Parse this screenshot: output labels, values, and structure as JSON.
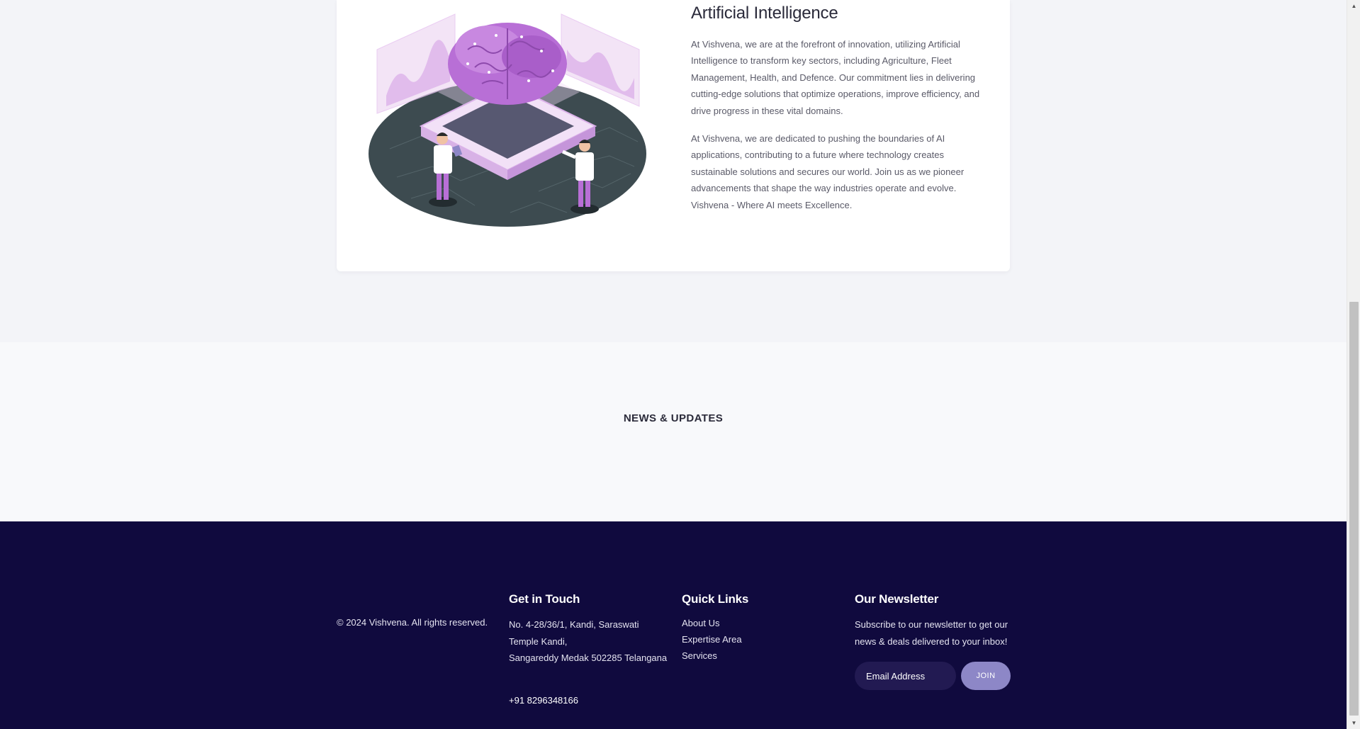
{
  "ai": {
    "title": "Artificial Intelligence",
    "paragraph1": "At Vishvena, we are at the forefront of innovation, utilizing Artificial Intelligence to transform key sectors, including Agriculture, Fleet Management, Health, and Defence. Our commitment lies in delivering cutting-edge solutions that optimize operations, improve efficiency, and drive progress in these vital domains.",
    "paragraph2": "At Vishvena, we are dedicated to pushing the boundaries of AI applications, contributing to a future where technology creates sustainable solutions and secures our world. Join us as we pioneer advancements that shape the way industries operate and evolve. Vishvena - Where AI meets Excellence."
  },
  "news": {
    "title": "NEWS & UPDATES"
  },
  "footer": {
    "copyright": "© 2024 Vishvena. All rights reserved.",
    "get_in_touch": {
      "heading": "Get in Touch",
      "address_line1": "No. 4-28/36/1, Kandi, Saraswati",
      "address_line2": "Temple Kandi,",
      "address_line3": "Sangareddy Medak 502285 Telangana",
      "phone": "+91 8296348166"
    },
    "quick_links": {
      "heading": "Quick Links",
      "items": [
        "About Us",
        "Expertise Area",
        "Services"
      ]
    },
    "newsletter": {
      "heading": "Our Newsletter",
      "description": "Subscribe to our newsletter to get our news & deals delivered to your inbox!",
      "email_placeholder": "Email Address",
      "join_label": "JOIN"
    }
  },
  "colors": {
    "footer_bg": "#100a3e",
    "join_button": "#8d87c7",
    "illustration_purple": "#b86fd6",
    "platform_dark": "#3b4a4f"
  },
  "icons": {
    "scroll_up": "▲",
    "scroll_down": "▼"
  }
}
